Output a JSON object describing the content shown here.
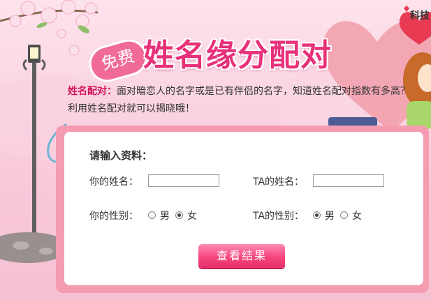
{
  "header": {
    "top_right_text": "科技",
    "badge": "免费",
    "title": "姓名缘分配对"
  },
  "intro": {
    "keyword": "姓名配对：",
    "line1_rest": "面对暗恋人的名字或是已有伴侣的名字，知道姓名配对指数有多高？",
    "line2": "利用姓名配对就可以揭晓哦！"
  },
  "form": {
    "section_title": "请输入资料：",
    "your_name_label": "你的姓名：",
    "ta_name_label": "TA的姓名：",
    "your_name_value": "",
    "ta_name_value": "",
    "your_gender_label": "你的性别：",
    "ta_gender_label": "TA的性别：",
    "male": "男",
    "female": "女",
    "your_gender_selected": "女",
    "ta_gender_selected": "男",
    "submit": "查看结果"
  },
  "colors": {
    "accent": "#e8317a",
    "keyword": "#d2145a",
    "card_border": "#f59cb0"
  }
}
